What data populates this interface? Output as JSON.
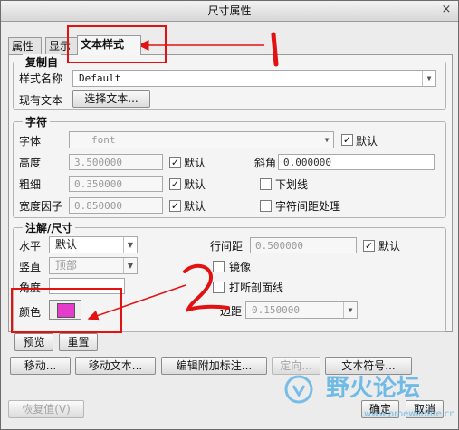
{
  "window": {
    "title": "尺寸属性",
    "close": "×"
  },
  "tabs": [
    {
      "label": "属性"
    },
    {
      "label": "显示"
    },
    {
      "label": "文本样式"
    }
  ],
  "copy_from": {
    "title": "复制自",
    "style_name_label": "样式名称",
    "style_name_value": "Default",
    "existing_text_label": "现有文本",
    "select_text_button": "选择文本..."
  },
  "char": {
    "title": "字符",
    "font_label": "字体",
    "font_value": "font",
    "default_label": "默认",
    "height_label": "高度",
    "height_value": "3.500000",
    "slant_label": "斜角",
    "slant_value": "0.000000",
    "thickness_label": "粗细",
    "thickness_value": "0.350000",
    "underline_label": "下划线",
    "width_factor_label": "宽度因子",
    "width_factor_value": "0.850000",
    "kerning_label": "字符间距处理"
  },
  "note": {
    "title": "注解/尺寸",
    "horizontal_label": "水平",
    "horizontal_value": "默认",
    "vertical_label": "竖直",
    "vertical_value": "顶部",
    "angle_label": "角度",
    "color_label": "颜色",
    "line_spacing_label": "行间距",
    "line_spacing_value": "0.500000",
    "mirror_label": "镜像",
    "break_hatch_label": "打断剖面线",
    "margin_label": "边距",
    "margin_value": "0.150000",
    "color_value": "#e53ccb"
  },
  "buttons": {
    "preview": "预览",
    "reset": "重置",
    "move": "移动...",
    "move_text": "移动文本...",
    "edit_attach": "编辑附加标注...",
    "orient": "定向...",
    "text_symbol": "文本符号...",
    "restore": "恢复值(V)",
    "ok": "确定",
    "cancel": "取消"
  },
  "annotations": {
    "mark1": "1",
    "mark2": "2"
  },
  "watermark": {
    "text": "野火论坛",
    "url": "www.proewildfire.cn"
  },
  "colors": {
    "highlight": "#e21212",
    "swatch": "#e53ccb",
    "watermark": "#5bb2e6"
  }
}
